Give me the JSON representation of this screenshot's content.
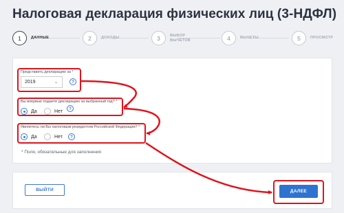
{
  "page": {
    "title": "Налоговая декларация физических лиц (3-НДФЛ)"
  },
  "steps": [
    {
      "number": "1",
      "label": "ДАННЫЕ",
      "active": true
    },
    {
      "number": "2",
      "label": "ДОХОДЫ",
      "active": false
    },
    {
      "number": "3",
      "label": "ВЫБОР\nВЫЧЕТОВ",
      "active": false
    },
    {
      "number": "4",
      "label": "ВЫЧЕТЫ",
      "active": false
    },
    {
      "number": "5",
      "label": "ПРОСМОТР",
      "active": false
    }
  ],
  "form": {
    "year_label": "Представить декларацию за *",
    "year_value": "2019",
    "first_time_label": "Вы впервые подаете декларацию за выбранный год? *",
    "resident_label": "Являетесь ли Вы налоговым резидентом Российской Федерации? *",
    "option_yes": "Да",
    "option_no": "Нет",
    "first_time_selected": "Да",
    "resident_selected": "Да",
    "required_note": "* Поля, обязательные для заполнения",
    "help_glyph": "?",
    "chevron_glyph": "⌄"
  },
  "footer": {
    "exit_label": "ВЫЙТИ",
    "next_label": "ДАЛЕЕ"
  },
  "colors": {
    "accent": "#2f73d1",
    "highlight": "#e1121b"
  },
  "icons": {
    "help": "question-circle-icon",
    "select": "chevron-down-icon"
  }
}
